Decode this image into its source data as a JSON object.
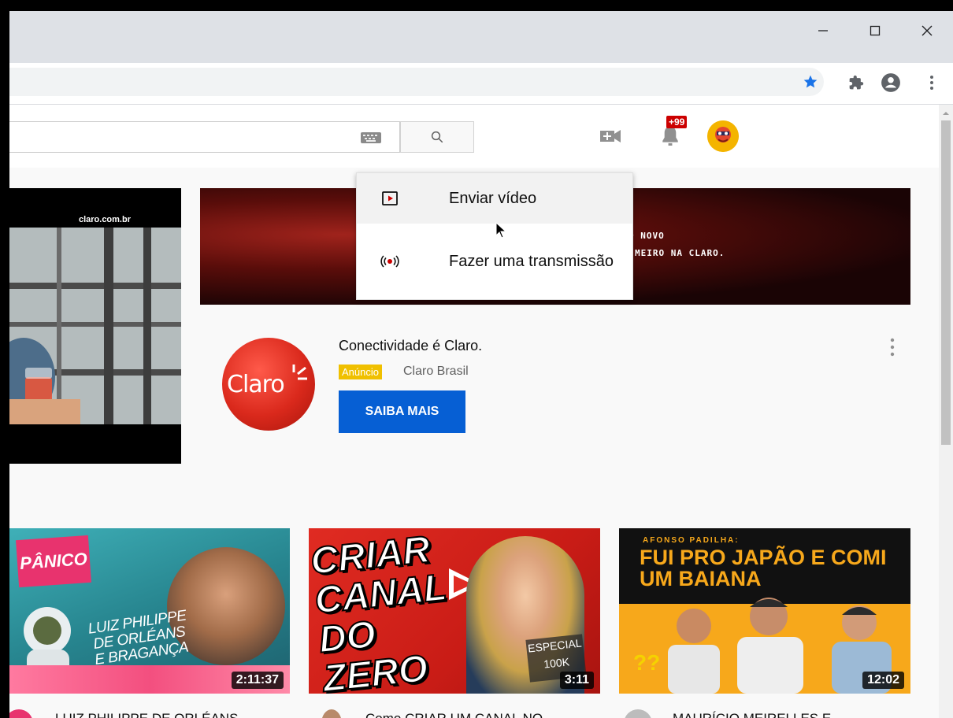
{
  "window": {
    "minimize_label": "—",
    "maximize_label": "☐",
    "close_label": "✕"
  },
  "browser_toolbar": {
    "icons": [
      "star-icon",
      "extensions-puzzle-icon",
      "account-circle-icon",
      "menu-kebab-icon"
    ]
  },
  "masthead": {
    "search_placeholder": "",
    "notification_badge": "+99"
  },
  "create_menu": {
    "items": [
      {
        "label": "Enviar vídeo",
        "icon": "upload-video-icon"
      },
      {
        "label": "Fazer uma transmissão",
        "icon": "live-broadcast-icon"
      }
    ]
  },
  "ad": {
    "video_watermark": "claro.com.br",
    "banner_line1": "O NOVO",
    "banner_line2": "MEIRO NA CLARO.",
    "logo_text": "Claro",
    "title": "Conectividade é Claro.",
    "badge": "Anúncio",
    "advertiser": "Claro Brasil",
    "cta": "SAIBA MAIS"
  },
  "videos": [
    {
      "thumb_title": "LUIZ PHILIPPE DE ORLÉANS E BRAGANÇA",
      "thumb_brand": "PÂNICO",
      "duration": "2:11:37",
      "title": "LUIZ PHILIPPE DE ORLÉANS"
    },
    {
      "thumb_title": "CRIAR CANAL DO ZERO",
      "thumb_badge": "ESPECIAL 100K",
      "duration": "3:11",
      "title": "Como CRIAR UM CANAL NO"
    },
    {
      "thumb_title": "FUI PRO JAPÃO E COMI UM BAIANA",
      "thumb_kicker": "AFONSO PADILHA:",
      "duration": "12:02",
      "title": "MAURÍCIO MEIRELLES E"
    }
  ],
  "colors": {
    "accent_blue": "#065fd4",
    "badge_yellow": "#f0c000",
    "claro_red": "#da291c",
    "notif_red": "#cc0000"
  }
}
